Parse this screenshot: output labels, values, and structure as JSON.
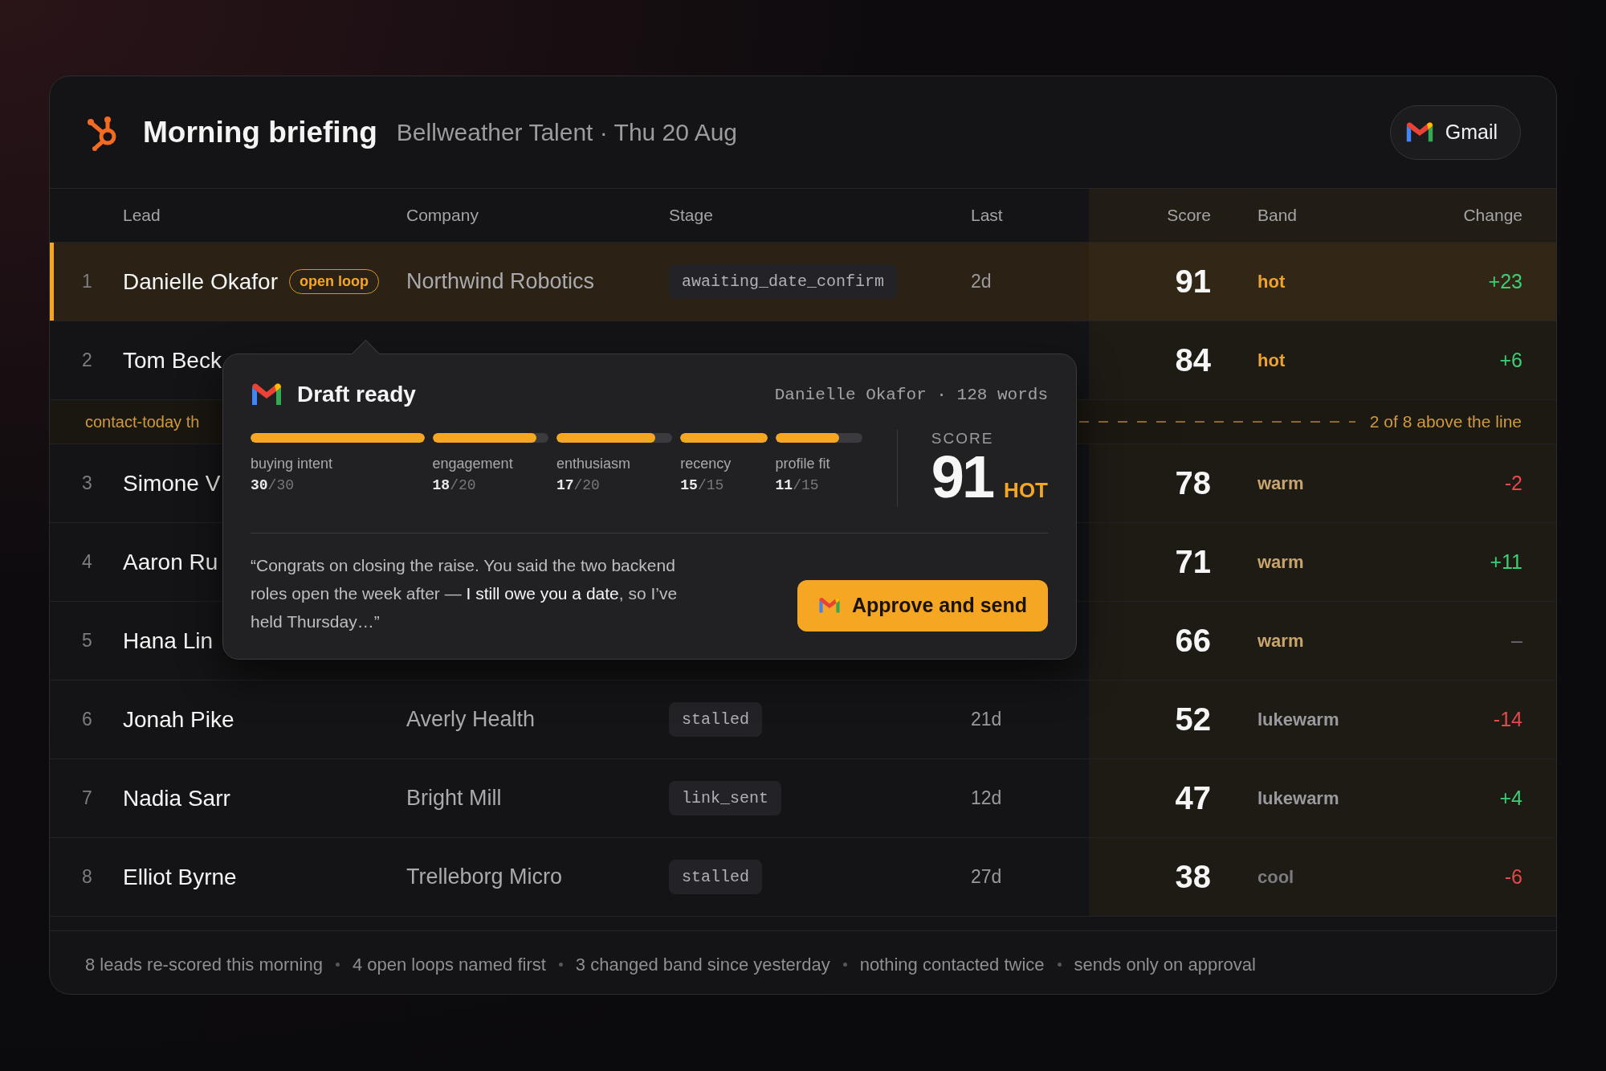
{
  "header": {
    "title": "Morning briefing",
    "subtitle": "Bellweather Talent · Thu 20 Aug",
    "gmail_button": "Gmail"
  },
  "table": {
    "columns": [
      "Lead",
      "Company",
      "Stage",
      "Last",
      "Score",
      "Band",
      "Change"
    ],
    "rows": [
      {
        "kind": "lead",
        "number": "1",
        "name": "Danielle Okafor",
        "badge": "open loop",
        "company": "Northwind Robotics",
        "stage": "awaiting_date_confirm",
        "last": "2d",
        "score": "91",
        "band": "hot",
        "color": "#f0a22e",
        "change": {
          "text": "+23",
          "color": "#3ecf76"
        },
        "selected": true
      },
      {
        "kind": "lead",
        "number": "2",
        "name": "Tom Beck",
        "score": "84",
        "band": "hot",
        "color": "#f0a22e",
        "change": {
          "text": "+6",
          "color": "#3ecf76"
        },
        "selected": false
      },
      {
        "kind": "cutoff",
        "label": "contact-today th",
        "note": "2 of 8 above the line"
      },
      {
        "kind": "lead",
        "number": "3",
        "name": "Simone V",
        "score": "78",
        "band": "warm",
        "color": "#c9a56e",
        "change": {
          "text": "-2",
          "color": "#e5484d"
        },
        "selected": false
      },
      {
        "kind": "lead",
        "number": "4",
        "name": "Aaron Ru",
        "score": "71",
        "band": "warm",
        "color": "#c9a56e",
        "change": {
          "text": "+11",
          "color": "#3ecf76"
        },
        "selected": false
      },
      {
        "kind": "lead",
        "number": "5",
        "name": "Hana Lin",
        "score": "66",
        "band": "warm",
        "color": "#c9a56e",
        "change": {
          "text": "–",
          "color": "#6b6b70"
        },
        "selected": false
      },
      {
        "kind": "lead",
        "number": "6",
        "name": "Jonah Pike",
        "company": "Averly Health",
        "stage": "stalled",
        "last": "21d",
        "score": "52",
        "band": "lukewarm",
        "color": "#9a9a9e",
        "change": {
          "text": "-14",
          "color": "#e5484d"
        },
        "selected": false
      },
      {
        "kind": "lead",
        "number": "7",
        "name": "Nadia Sarr",
        "company": "Bright Mill",
        "stage": "link_sent",
        "last": "12d",
        "score": "47",
        "band": "lukewarm",
        "color": "#9a9a9e",
        "change": {
          "text": "+4",
          "color": "#3ecf76"
        },
        "selected": false
      },
      {
        "kind": "lead",
        "number": "8",
        "name": "Elliot Byrne",
        "company": "Trelleborg Micro",
        "stage": "stalled",
        "last": "27d",
        "score": "38",
        "band": "cool",
        "color": "#7c7c80",
        "change": {
          "text": "-6",
          "color": "#e5484d"
        },
        "selected": false
      }
    ]
  },
  "draft": {
    "title": "Draft ready",
    "meta": "Danielle Okafor · 128 words",
    "factors": [
      {
        "label": "buying intent",
        "value": "30",
        "max": "/30",
        "level": 1
      },
      {
        "label": "engagement",
        "value": "18",
        "max": "/20",
        "level": 0.9
      },
      {
        "label": "enthusiasm",
        "value": "17",
        "max": "/20",
        "level": 0.85
      },
      {
        "label": "recency",
        "value": "15",
        "max": "/15",
        "level": 1
      },
      {
        "label": "profile fit",
        "value": "11",
        "max": "/15",
        "level": 0.733
      }
    ],
    "score_label": "SCORE",
    "score": "91",
    "band": "HOT",
    "quote": "“Congrats on closing the raise. You said the two backend roles open the week after — **I still owe you a date**, so I’ve held Thursday…”",
    "approve_button": "Approve and send"
  },
  "footer": [
    "8 leads re-scored this morning",
    "4 open loops named first",
    "3 changed band since yesterday",
    "nothing contacted twice",
    "sends only on approval"
  ]
}
